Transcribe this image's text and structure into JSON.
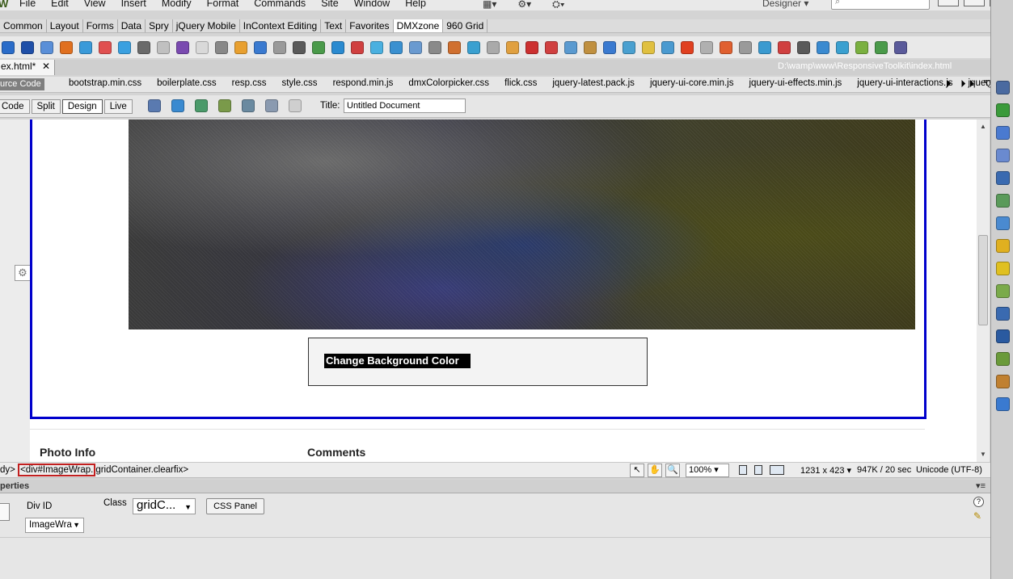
{
  "menubar": {
    "logo": "W",
    "items": [
      "File",
      "Edit",
      "View",
      "Insert",
      "Modify",
      "Format",
      "Commands",
      "Site",
      "Window",
      "Help"
    ],
    "workspace": "Designer",
    "window_buttons": [
      "–",
      "□",
      "✕"
    ]
  },
  "insert_tabs": [
    "Common",
    "Layout",
    "Forms",
    "Data",
    "Spry",
    "jQuery Mobile",
    "InContext Editing",
    "Text",
    "Favorites",
    "DMXzone",
    "960 Grid"
  ],
  "active_insert_tab": "DMXzone",
  "toolbar_colors": [
    "#2a6cc9",
    "#1f4fa8",
    "#5a8fd8",
    "#e07020",
    "#3a9ad9",
    "#e05050",
    "#3aa0e0",
    "#6a6a6a",
    "#c0c0c0",
    "#7a4ab0",
    "#d9d9d9",
    "#888888",
    "#e8a030",
    "#3a7ad0",
    "#9a9a9a",
    "#5a5a5a",
    "#4a9a4a",
    "#2a8ad0",
    "#d04040",
    "#4ab0e0",
    "#3a90d0",
    "#6a9ad0",
    "#8a8a8a",
    "#d07030",
    "#3aa0d0",
    "#aaaaaa",
    "#e0a040",
    "#cc3030",
    "#d04040",
    "#5a9ad0",
    "#c09040",
    "#3a7ad0",
    "#4aa0d0",
    "#e0c040",
    "#4a9ad0",
    "#e04020",
    "#b0b0b0",
    "#e06030",
    "#9a9a9a",
    "#3a9ad0",
    "#d04040",
    "#5a5a5a",
    "#3a8ad0",
    "#3aa0d0",
    "#7ab040",
    "#4a9a4a",
    "#5a5a9a"
  ],
  "document": {
    "tab_name": "ex.html*",
    "close_label": "✕",
    "path": "D:\\wamp\\www\\ResponsiveToolkit\\index.html"
  },
  "related_files": {
    "source_label": "urce Code",
    "files": [
      "bootstrap.min.css",
      "boilerplate.css",
      "resp.css",
      "style.css",
      "respond.min.js",
      "dmxColorpicker.css",
      "flick.css",
      "jquery-latest.pack.js",
      "jquery-ui-core.min.js",
      "jquery-ui-effects.min.js",
      "jquery-ui-interactions.js",
      "jquery.s"
    ],
    "overflow": "⏵ ⏵⏵ ▽"
  },
  "doc_toolbar": {
    "views": [
      "Code",
      "Split",
      "Design",
      "Live"
    ],
    "active_view": "Design",
    "title_label": "Title:",
    "title_value": "Untitled Document"
  },
  "design": {
    "button_text": "Change Background Color",
    "photo_info_heading": "Photo Info",
    "comments_heading": "Comments"
  },
  "statusbar": {
    "tag_prefix": "dy>",
    "selected_tag": "<div#ImageWrap.",
    "tag_rest": "gridContainer.clearfix>",
    "zoom": "100%",
    "dimensions": "1231 x 423",
    "size": "947K / 20 sec",
    "encoding": "Unicode (UTF-8)"
  },
  "properties": {
    "panel_title": "perties",
    "div_id_label": "Div ID",
    "div_id_value": "ImageWra",
    "class_label": "Class",
    "class_value": "gridC...",
    "css_panel_label": "CSS Panel",
    "help": "?"
  },
  "right_dock_colors": [
    "#4a6aa0",
    "#3a9a3a",
    "#4a7ad0",
    "#6a8ad0",
    "#3a6ab0",
    "#5a9a5a",
    "#4a8ad0",
    "#e0b020",
    "#e0c020",
    "#7aaa4a",
    "#3a6ab0",
    "#2a5aa0",
    "#6a9a3a",
    "#c08030",
    "#3a7ad0"
  ]
}
